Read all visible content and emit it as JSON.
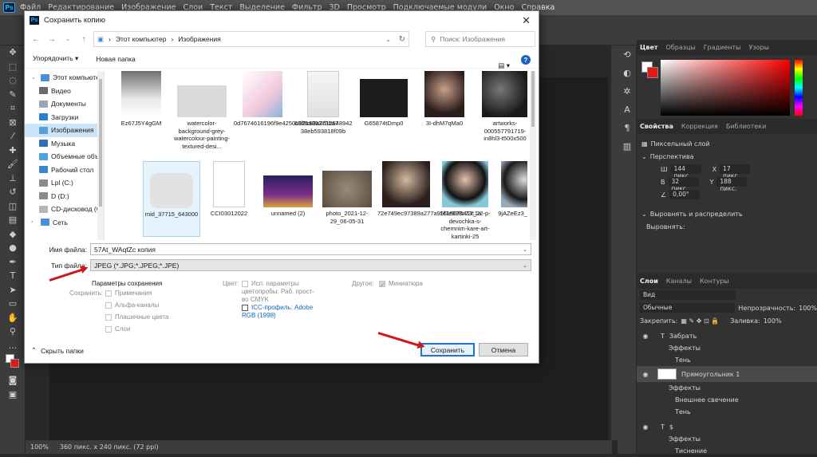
{
  "menubar": {
    "app_icon": "Ps",
    "items": [
      "Файл",
      "Редактирование",
      "Изображение",
      "Слои",
      "Текст",
      "Выделение",
      "Фильтр",
      "3D",
      "Просмотр",
      "Подключаемые модули",
      "Окно",
      "Справка"
    ]
  },
  "status": {
    "zoom": "100%",
    "doc_info": "360 пикс. x 240 пикс. (72 ppi)"
  },
  "panels": {
    "color_tabs": [
      "Цвет",
      "Образцы",
      "Градиенты",
      "Узоры"
    ],
    "props_tabs": [
      "Свойства",
      "Коррекция",
      "Библиотеки"
    ],
    "pixel_layer": "Пиксельный слой",
    "perspective": "Перспектива",
    "w_label": "Ш",
    "w_val": "144 пикс.",
    "x_label": "X",
    "x_val": "17 пикс.",
    "h_label": "В",
    "h_val": "32 пикс.",
    "y_label": "Y",
    "y_val": "188 пикс.",
    "angle_val": "0,00°",
    "align": "Выровнять и распределить",
    "align_label": "Выровнять:",
    "layers_tabs": [
      "Слои",
      "Каналы",
      "Контуры"
    ],
    "kind": "Вид",
    "blend": "Обычные",
    "opacity_label": "Непрозрачность:",
    "opacity_val": "100%",
    "lock_label": "Закрепить:",
    "fill_label": "Заливка:",
    "fill_val": "100%",
    "layers": {
      "l1": "Забрать",
      "l1_eff": "Эффекты",
      "l1_e1": "Тень",
      "l2": "Прямоугольник 1",
      "l2_eff": "Эффекты",
      "l2_e1": "Внешнее свечение",
      "l2_e2": "Тень",
      "l3": "$",
      "l3_eff": "Эффекты",
      "l3_e1": "Тиснение"
    }
  },
  "dialog": {
    "title": "Сохранить копию",
    "breadcrumb": [
      "Этот компьютер",
      "Изображения"
    ],
    "search_placeholder": "Поиск: Изображения",
    "organize": "Упорядочить",
    "new_folder": "Новая папка",
    "sidebar": [
      "Этот компьютер",
      "Видео",
      "Документы",
      "Загрузки",
      "Изображения",
      "Музыка",
      "Объемные объ",
      "Рабочий стол",
      "Lpl (C:)",
      "D (D:)",
      "CD-дисковод (G",
      "Сеть"
    ],
    "files": [
      {
        "name": "Ez67J5Y4gGM"
      },
      {
        "name": "watercolor-background-grey-watercolour-painting-textured-desi..."
      },
      {
        "name": "0d7674616196f9e4250c625a89373ba7"
      },
      {
        "name": "63f9c53a2d12548942 38eb593818f09b"
      },
      {
        "name": "G65874tDmp0"
      },
      {
        "name": "3I-dhM7qMa0"
      },
      {
        "name": "artworks-000557791719-in8hl3-t500x500"
      },
      {
        "name": "mid_37715_643000"
      },
      {
        "name": "CCI03012022"
      },
      {
        "name": "unnamed (2)"
      },
      {
        "name": "photo_2021-12-29_06-05-31"
      },
      {
        "name": "72e749ec97389a277a95f1e998c73c1a"
      },
      {
        "name": "1615075417_22-p-devochka-s-chemnim-kare-art-kartinki-25"
      },
      {
        "name": "9jAZeEz3_400x400"
      }
    ],
    "filename_label": "Имя файла:",
    "filename_value": "57At_WAqfZc копия",
    "filetype_label": "Тип файла:",
    "filetype_value": "JPEG (*.JPG;*.JPEG;*.JPE)",
    "save_options_title": "Параметры сохранения",
    "save_label": "Сохранить:",
    "opt_notes": "Примечания",
    "opt_alpha": "Альфа-каналы",
    "opt_spot": "Плашечные цвета",
    "opt_layers": "Слои",
    "color_label": "Цвет:",
    "opt_proof": "Исп. параметры цветопробы: Раб. прост-во CMYK",
    "opt_icc": "ICC-профиль: Adobe RGB (1998)",
    "other_label": "Другое:",
    "opt_thumb": "Миниатюра",
    "hide_folders": "Скрыть папки",
    "save_button": "Сохранить",
    "cancel_button": "Отмена"
  }
}
